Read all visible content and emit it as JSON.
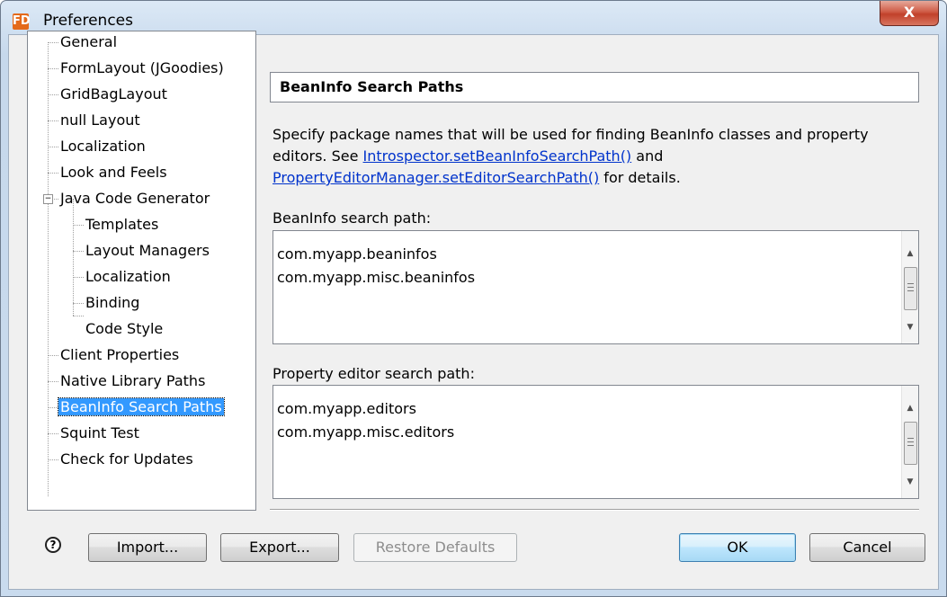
{
  "window": {
    "title": "Preferences",
    "app_icon": "FD",
    "close_glyph": "X"
  },
  "tree": {
    "items": [
      {
        "label": "General"
      },
      {
        "label": "FormLayout (JGoodies)"
      },
      {
        "label": "GridBagLayout"
      },
      {
        "label": "null Layout"
      },
      {
        "label": "Localization"
      },
      {
        "label": "Look and Feels"
      },
      {
        "label": "Java Code Generator"
      },
      {
        "label": "Templates"
      },
      {
        "label": "Layout Managers"
      },
      {
        "label": "Localization"
      },
      {
        "label": "Binding"
      },
      {
        "label": "Code Style"
      },
      {
        "label": "Client Properties"
      },
      {
        "label": "Native Library Paths"
      },
      {
        "label": "BeanInfo Search Paths"
      },
      {
        "label": "Squint Test"
      },
      {
        "label": "Check for Updates"
      }
    ],
    "selected": "BeanInfo Search Paths"
  },
  "pane": {
    "title": "BeanInfo Search Paths",
    "desc_part1": "Specify package names that will be used for finding BeanInfo classes and property editors. See ",
    "link1": "Introspector.setBeanInfoSearchPath()",
    "desc_part2": " and ",
    "link2": "PropertyEditorManager.setEditorSearchPath()",
    "desc_part3": " for details.",
    "beaninfo_label": "BeanInfo search path:",
    "beaninfo_lines": [
      "com.myapp.beaninfos",
      "com.myapp.misc.beaninfos"
    ],
    "editor_label": "Property editor search path:",
    "editor_lines": [
      "com.myapp.editors",
      "com.myapp.misc.editors"
    ]
  },
  "buttons": {
    "help": "?",
    "import": "Import...",
    "export": "Export...",
    "restore": "Restore Defaults",
    "ok": "OK",
    "cancel": "Cancel"
  },
  "colors": {
    "selection": "#3399ff",
    "link": "#0033cc",
    "close": "#c1412a"
  }
}
